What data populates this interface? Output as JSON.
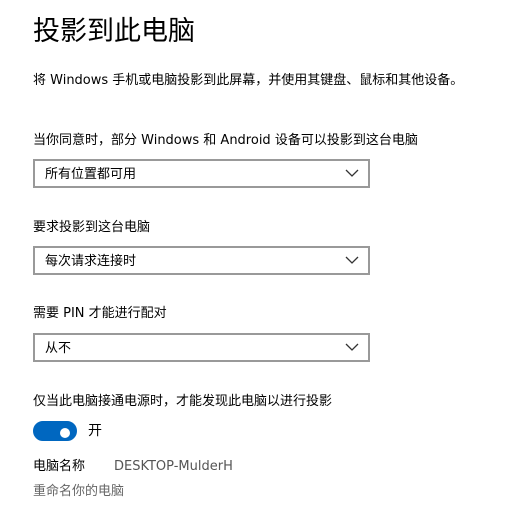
{
  "title": "投影到此电脑",
  "description": "将 Windows 手机或电脑投影到此屏幕，并使用其键盘、鼠标和其他设备。",
  "availability": {
    "label": "当你同意时，部分 Windows 和 Android 设备可以投影到这台电脑",
    "selected": "所有位置都可用"
  },
  "ask_to_project": {
    "label": "要求投影到这台电脑",
    "selected": "每次请求连接时"
  },
  "require_pin": {
    "label": "需要 PIN 才能进行配对",
    "selected": "从不"
  },
  "power": {
    "label": "仅当此电脑接通电源时，才能发现此电脑以进行投影",
    "toggle_state": "开",
    "toggle_on": true
  },
  "pc_name": {
    "label": "电脑名称",
    "value": "DESKTOP-MulderH"
  },
  "rename_link": "重命名你的电脑",
  "colors": {
    "accent": "#0067c0",
    "dropdown_border": "#999999",
    "secondary_text": "#555555",
    "link_text": "#666666"
  },
  "icons": {
    "dropdown": "chevron-down-icon"
  }
}
